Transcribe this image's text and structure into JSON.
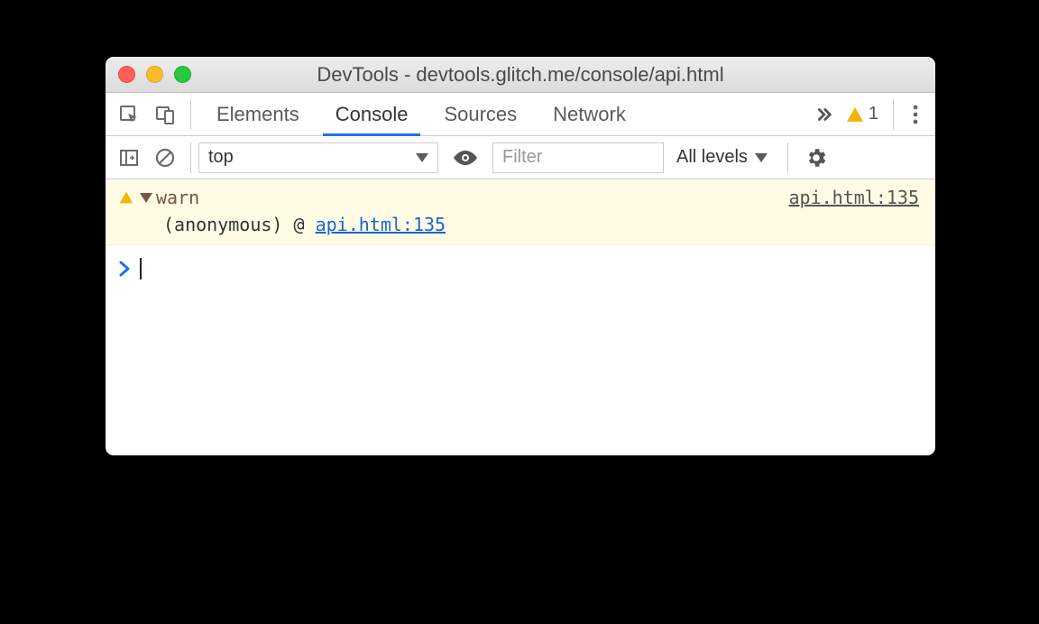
{
  "window": {
    "title": "DevTools - devtools.glitch.me/console/api.html"
  },
  "tabs": {
    "elements": "Elements",
    "console": "Console",
    "sources": "Sources",
    "network": "Network"
  },
  "warning_count": "1",
  "toolbar": {
    "context": "top",
    "filter_placeholder": "Filter",
    "levels": "All levels"
  },
  "console": {
    "warn_label": "warn",
    "source_link": "api.html:135",
    "trace_anon": "(anonymous)",
    "trace_at": "@",
    "trace_link": "api.html:135"
  }
}
